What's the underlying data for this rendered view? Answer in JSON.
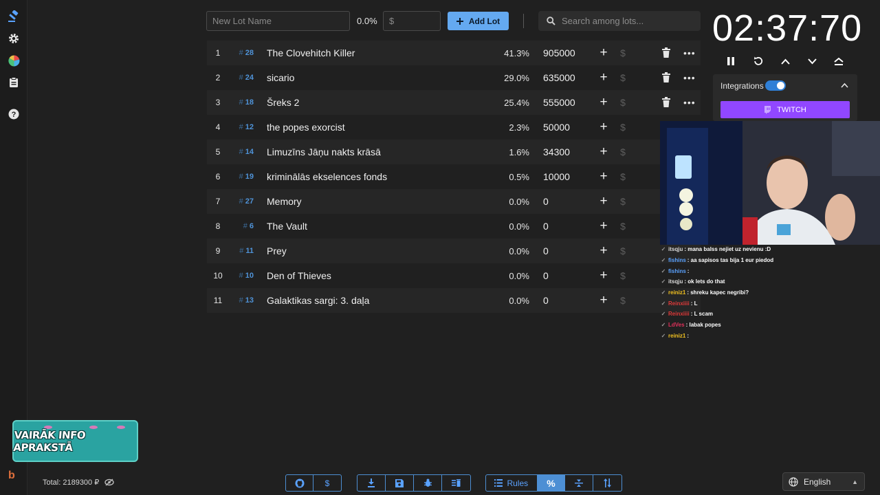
{
  "toolbar": {
    "lot_name_placeholder": "New Lot Name",
    "percent": "0.0%",
    "price_placeholder": "$",
    "add_lot_label": "Add Lot",
    "search_placeholder": "Search among lots..."
  },
  "lots": [
    {
      "index": "1",
      "code": "28",
      "name": "The Clovehitch Killer",
      "percent": "41.3%",
      "amount": "905000"
    },
    {
      "index": "2",
      "code": "24",
      "name": "sicario",
      "percent": "29.0%",
      "amount": "635000"
    },
    {
      "index": "3",
      "code": "18",
      "name": "Šreks 2",
      "percent": "25.4%",
      "amount": "555000"
    },
    {
      "index": "4",
      "code": "12",
      "name": "the popes exorcist",
      "percent": "2.3%",
      "amount": "50000"
    },
    {
      "index": "5",
      "code": "14",
      "name": "Limuzīns Jāņu nakts krāsā",
      "percent": "1.6%",
      "amount": "34300"
    },
    {
      "index": "6",
      "code": "19",
      "name": "kriminālās ekselences fonds",
      "percent": "0.5%",
      "amount": "10000"
    },
    {
      "index": "7",
      "code": "27",
      "name": "Memory",
      "percent": "0.0%",
      "amount": "0"
    },
    {
      "index": "8",
      "code": "6",
      "name": "The Vault",
      "percent": "0.0%",
      "amount": "0"
    },
    {
      "index": "9",
      "code": "11",
      "name": "Prey",
      "percent": "0.0%",
      "amount": "0"
    },
    {
      "index": "10",
      "code": "10",
      "name": "Den of Thieves",
      "percent": "0.0%",
      "amount": "0"
    },
    {
      "index": "11",
      "code": "13",
      "name": "Galaktikas sargi: 3. daļa",
      "percent": "0.0%",
      "amount": "0"
    }
  ],
  "timer": {
    "display": "02:37:70",
    "integrations_label": "Integrations",
    "integrations_enabled": true,
    "twitch_label": "TWITCH"
  },
  "chat": [
    {
      "user": "itsqju",
      "text": ": mana balss nejiet uz nevienu :D",
      "color": "#d9d9d9"
    },
    {
      "user": "fishins",
      "text": ": aa sapisos tas bija 1 eur piedod",
      "color": "#5aa2ff"
    },
    {
      "user": "fishins",
      "text": ":",
      "color": "#5aa2ff"
    },
    {
      "user": "itsqju",
      "text": ": ok lets do that",
      "color": "#d9d9d9"
    },
    {
      "user": "reiniz1",
      "text": ": shreku kapec negribi?",
      "color": "#f0c020"
    },
    {
      "user": "Reinxiiii",
      "text": ": L",
      "color": "#e03a3a"
    },
    {
      "user": "Reinxiiii",
      "text": ": L scam",
      "color": "#e03a3a"
    },
    {
      "user": "LdVes",
      "text": ": labak popes",
      "color": "#e0305a"
    },
    {
      "user": "reiniz1",
      "text": ":",
      "color": "#f0c020"
    }
  ],
  "promo_text": "VAIRĀK INFO APRAKSTĀ",
  "footer": {
    "total": "Total: 2189300 ₽",
    "rules_label": "Rules",
    "language": "English"
  },
  "colors": {
    "accent": "#64a9f0",
    "twitch": "#9147ff",
    "background": "#202020"
  }
}
